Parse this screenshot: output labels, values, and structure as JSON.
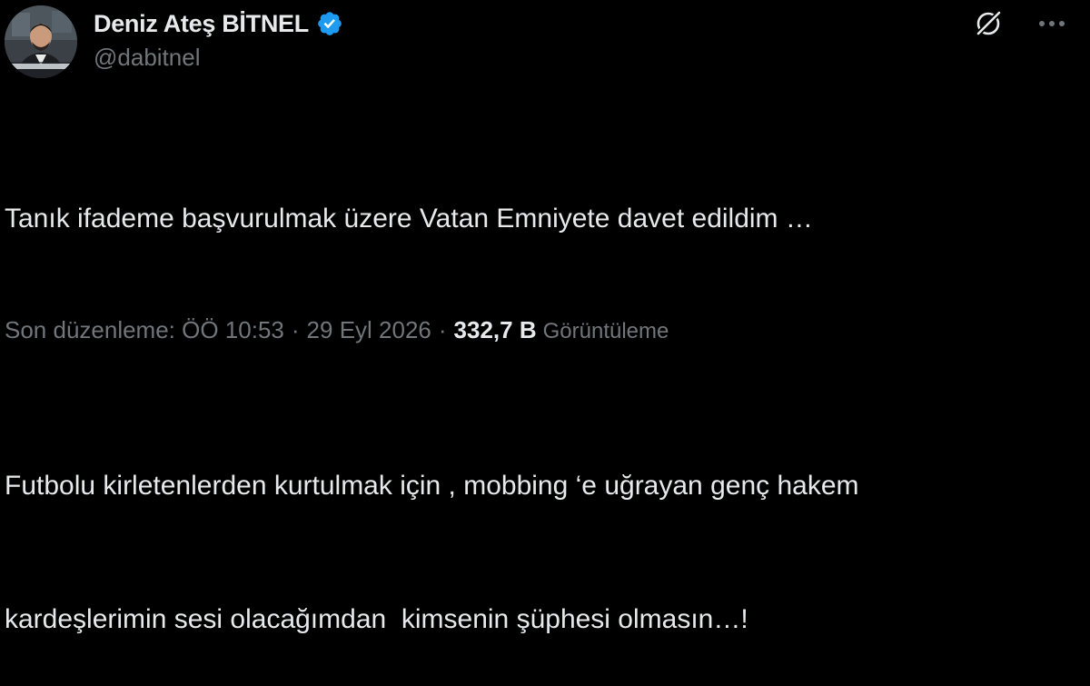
{
  "author": {
    "display_name": "Deniz Ateş BİTNEL",
    "handle": "@dabitnel",
    "verified_icon": "verified-badge-icon",
    "verified_color": "#1d9bf0"
  },
  "actions": {
    "grok_icon": "grok-icon",
    "more_icon": "more-options-icon"
  },
  "tweet": {
    "line1": "Tanık ifademe başvurulmak üzere Vatan Emniyete davet edildim …",
    "line2": "Futbolu kirletenlerden kurtulmak için , mobbing ‘e uğrayan genç hakem",
    "line3": "kardeşlerimin sesi olacağımdan  kimsenin şüphesi olmasın…!"
  },
  "meta": {
    "edited_time": "Son düzenleme: ÖÖ 10:53",
    "date": "29 Eyl 2026",
    "separator": "·",
    "views_count": "332,7 B",
    "views_label": "Görüntüleme"
  },
  "colors": {
    "background": "#000000",
    "primary_text": "#e7e9ea",
    "secondary_text": "#71767b",
    "accent": "#1d9bf0"
  }
}
